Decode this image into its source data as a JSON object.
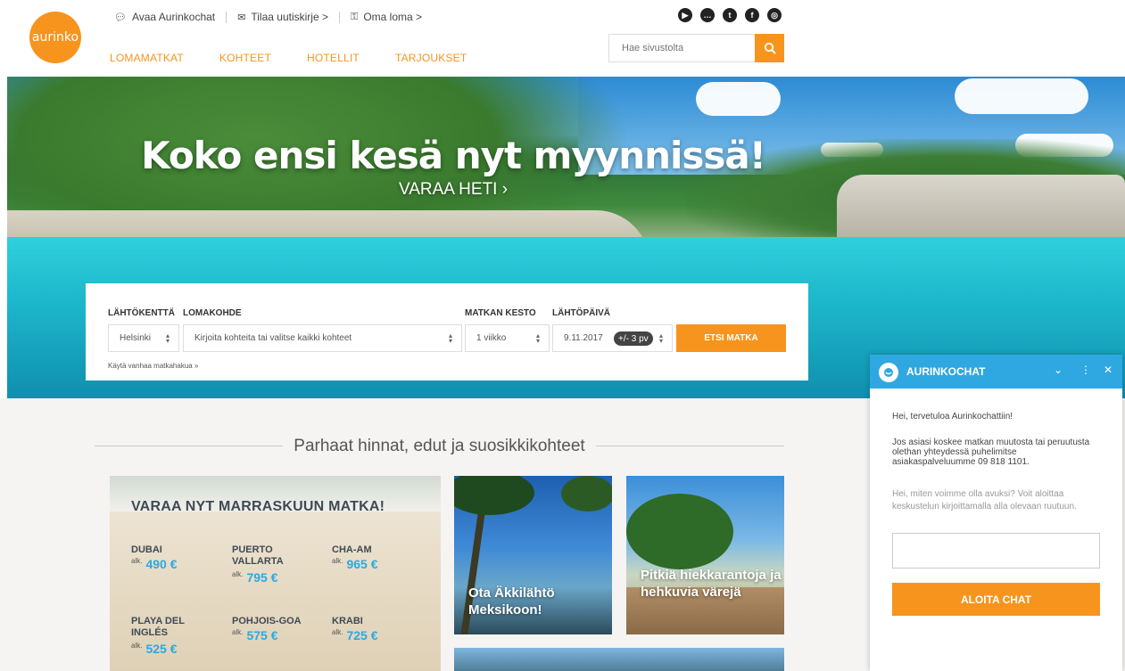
{
  "logo": "aurinko",
  "toplinks": [
    {
      "label": "Avaa Aurinkochat",
      "icon": "chat-bubbles-icon"
    },
    {
      "label": "Tilaa uutiskirje >",
      "icon": "envelope-icon"
    },
    {
      "label": "Oma loma >",
      "icon": "key-icon"
    }
  ],
  "nav": [
    "LOMAMATKAT",
    "KOHTEET",
    "HOTELLIT",
    "TARJOUKSET"
  ],
  "social": [
    "youtube-icon",
    "chat-icon",
    "twitter-icon",
    "facebook-icon",
    "instagram-icon"
  ],
  "search": {
    "placeholder": "Hae sivustolta"
  },
  "hero": {
    "title": "Koko ensi kesä nyt myynnissä!",
    "cta": "VARAA HETI ›"
  },
  "booking": {
    "labels": {
      "departure": "LÄHTÖKENTTÄ",
      "destination": "LOMAKOHDE",
      "duration": "MATKAN KESTO",
      "date": "LÄHTÖPÄIVÄ"
    },
    "departure": "Helsinki",
    "destination_placeholder": "Kirjoita kohteita tai valitse kaikki kohteet",
    "duration": "1 viikko",
    "date": "9.11.2017",
    "flex": "+/- 3 pv",
    "search_button": "ETSI MATKA",
    "old_search": "Käytä vanhaa matkahakua »"
  },
  "section_title": "Parhaat hinnat, edut ja suosikkikohteet",
  "promo": {
    "title": "VARAA NYT MARRASKUUN MATKA!",
    "alk": "alk.",
    "destinations": [
      {
        "name": "DUBAI",
        "price": "490 €"
      },
      {
        "name": "PUERTO VALLARTA",
        "price": "795 €"
      },
      {
        "name": "CHA-AM",
        "price": "965 €"
      },
      {
        "name": "PLAYA DEL INGLÉS",
        "price": "525 €"
      },
      {
        "name": "POHJOIS-GOA",
        "price": "575 €"
      },
      {
        "name": "KRABI",
        "price": "725 €"
      }
    ]
  },
  "cards": [
    {
      "caption": "Ota Äkkilähtö Meksikoon!"
    },
    {
      "caption": "Pitkiä hiekkarantoja ja hehkuvia värejä"
    }
  ],
  "chat": {
    "title": "AURINKOCHAT",
    "welcome": "Hei, tervetuloa Aurinkochattiin!",
    "info": "Jos asiasi koskee matkan muutosta tai peruutusta olethan yhteydessä puhelimitse asiakaspalveluumme 09 818 1101.",
    "prompt": "Hei, miten voimme olla avuksi? Voit aloittaa keskustelun kirjoittamalla alla olevaan ruutuun.",
    "button": "ALOITA CHAT"
  },
  "colors": {
    "accent": "#f7941d",
    "chat": "#2fa8e1",
    "price": "#2ba9e1"
  }
}
